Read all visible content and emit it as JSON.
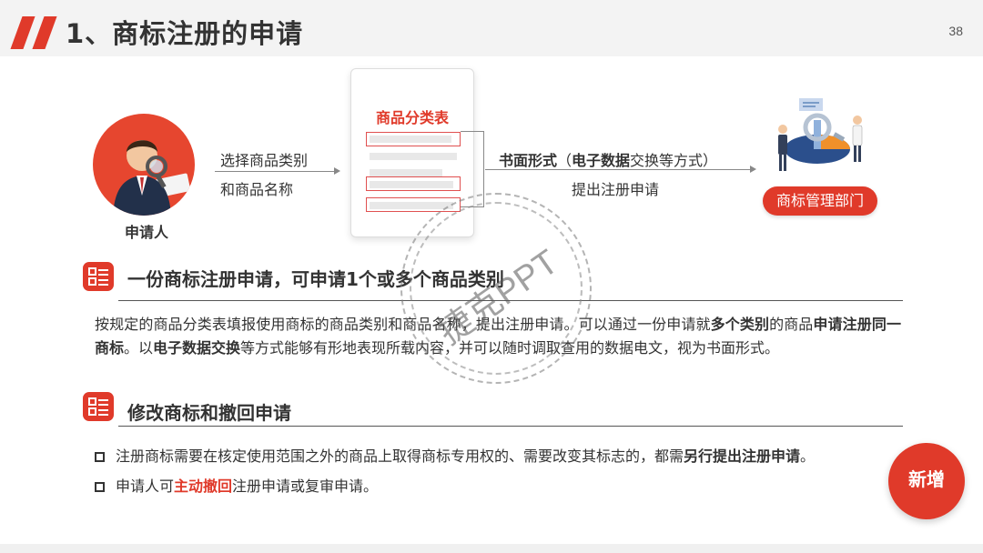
{
  "header": {
    "title": "1、商标注册的申请",
    "page_number": "38"
  },
  "flow": {
    "applicant_label": "申请人",
    "step1_line1": "选择商品类别",
    "step1_line2": "和商品名称",
    "doc_title": "商品分类表",
    "step2_bold_a": "书面形式",
    "step2_paren_open": "（",
    "step2_bold_b": "电子数据",
    "step2_rest": "交换等方式）",
    "step2_line2": "提出注册申请",
    "agency": "商标管理部门"
  },
  "section1": {
    "heading": "一份商标注册申请，可申请1个或多个商品类别",
    "p_t1": "按规定的商品分类表填报使用商标的商品类别和商品名称，提出注册申请。可以通过一份申请就",
    "p_b1": "多个类别",
    "p_t2": "的商品",
    "p_b2": "申请注册同一商标",
    "p_t3": "。以",
    "p_b3": "电子数据交换",
    "p_t4": "等方式能够有形地表现所载内容，并可以随时调取查用的数据电文，视为书面形式。"
  },
  "section2": {
    "heading": "修改商标和撤回申请",
    "bullet1_text": "注册商标需要在核定使用范围之外的商品上取得商标专用权的、需要改变其标志的，都需",
    "bullet1_bold": "另行提出注册申请",
    "bullet1_end": "。",
    "bullet2_text_a": "申请人可",
    "bullet2_red": "主动撤回",
    "bullet2_text_b": "注册申请或复审申请。"
  },
  "badge": "新增",
  "watermark": "捷克PPT",
  "colors": {
    "accent": "#e03a2a",
    "text": "#333333",
    "background": "#ffffff"
  }
}
